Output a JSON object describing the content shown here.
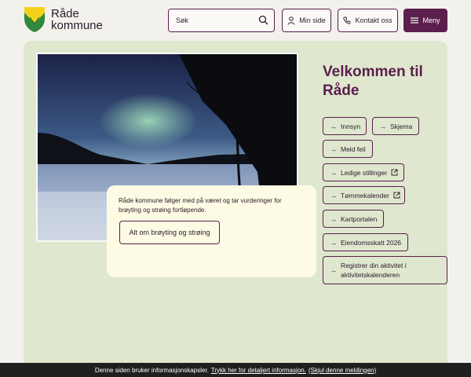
{
  "header": {
    "logo_line1": "Råde",
    "logo_line2": "kommune",
    "search_placeholder": "Søk",
    "min_side": "Min side",
    "kontakt": "Kontakt oss",
    "meny": "Meny"
  },
  "main": {
    "welcome_title": "Velkommen til Råde",
    "info_text": "Råde kommune følger med på været og tar vurderinger for brøyting og strøing fortløpende.",
    "info_button": "Alt om brøyting og strøing",
    "quick_links": [
      {
        "label": "Innsyn",
        "external": false
      },
      {
        "label": "Skjema",
        "external": false
      },
      {
        "label": "Meld feil",
        "external": false
      },
      {
        "label": "Ledige stillinger",
        "external": true
      },
      {
        "label": "Tømmekalender",
        "external": true
      },
      {
        "label": "Kartportalen",
        "external": false
      },
      {
        "label": "Eiendomsskatt 2026",
        "external": false
      },
      {
        "label": "Registrer din aktivitet i aktivitetskalenderen",
        "external": false
      }
    ]
  },
  "cookie_bar": {
    "text": "Denne siden bruker informasjonskapsler.",
    "details_link": "Trykk her for detaljert informasjon.",
    "hide_link": "(Skjul denne meldingen)"
  },
  "colors": {
    "brand": "#5a1f4d",
    "panel": "#dfe7cf",
    "info_box": "#fdfbe3",
    "page_bg": "#f3f1ec"
  }
}
